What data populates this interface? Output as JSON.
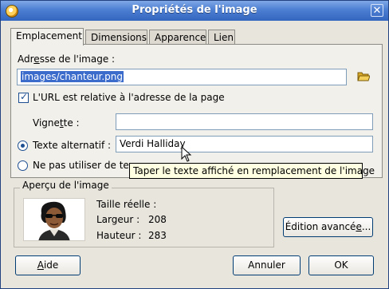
{
  "window": {
    "title": "Propriétés de l'image",
    "icon": "app-icon",
    "close": "close-icon"
  },
  "tabs": [
    {
      "label": "Emplacement",
      "active": true
    },
    {
      "label": "Dimensions",
      "active": false
    },
    {
      "label": "Apparence",
      "active": false
    },
    {
      "label": "Lien",
      "active": false
    }
  ],
  "location": {
    "address_label_pre": "Adr",
    "address_label_mnemonic": "e",
    "address_label_post": "sse de l'image :",
    "address_value": "images/chanteur.png",
    "browse_icon": "folder-open-icon",
    "relative_url_label": "L'URL est relative à l'adresse de la page",
    "relative_url_checked": true,
    "thumbnail_label_pre": "Vigne",
    "thumbnail_label_mnemonic": "t",
    "thumbnail_label_post": "te :",
    "thumbnail_value": "",
    "alt_text_label": "Texte alternatif :",
    "alt_text_value": "Verdi Halliday",
    "alt_text_selected": true,
    "no_alt_label": "Ne pas utiliser de tex",
    "tooltip": "Taper le texte affiché en remplacement de l'image"
  },
  "preview": {
    "title": "Aperçu de l'image",
    "actual_size_label": "Taille réelle :",
    "width_label": "Largeur :",
    "width_value": "208",
    "height_label": "Hauteur :",
    "height_value": "283"
  },
  "buttons": {
    "advanced_edit_pre": "Édition avancé",
    "advanced_edit_mnemonic": "e",
    "advanced_edit_post": "...",
    "help_mnemonic": "A",
    "help_post": "ide",
    "cancel": "Annuler",
    "ok": "OK"
  }
}
